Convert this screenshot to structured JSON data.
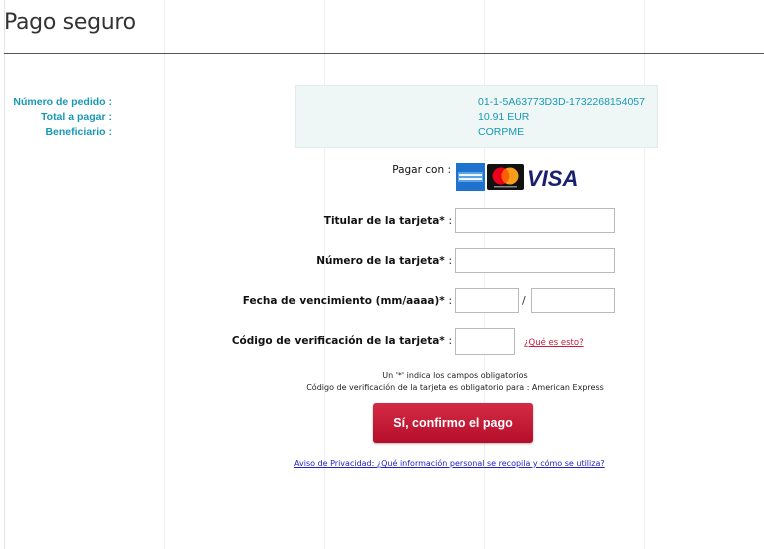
{
  "page": {
    "title": "Pago seguro"
  },
  "order": {
    "order_number_label": "Número de pedido :",
    "order_number": "01-1-5A63773D3D-1732268154057",
    "total_label": "Total a pagar :",
    "total": "10.91 EUR",
    "beneficiary_label": "Beneficiario :",
    "beneficiary": "CORPME"
  },
  "payment": {
    "pay_with_label": "Pagar con :",
    "cards": [
      "american-express-icon",
      "mastercard-icon",
      "visa-icon"
    ],
    "visa_text": "VISA"
  },
  "form": {
    "holder_label": "Titular de la tarjeta*",
    "holder_value": "",
    "number_label": "Número de la tarjeta*",
    "number_value": "",
    "expiry_label": "Fecha de vencimiento (mm/aaaa)*",
    "expiry_month": "",
    "expiry_year": "",
    "expiry_separator": "/",
    "cvv_label": "Código de verificación de la tarjeta*",
    "cvv_value": "",
    "cvv_help": "¿Qué es esto?",
    "colon": ":"
  },
  "notes": {
    "required_note": "Un '*' indica los campos obligatorios",
    "cvv_note": "Código de verificación de la tarjeta es obligatorio para : American Express"
  },
  "actions": {
    "confirm_label": "Sí, confirmo el pago"
  },
  "footer": {
    "privacy_link": "Aviso de Privacidad: ¿Qué información personal se recopila y cómo se utiliza?"
  },
  "colors": {
    "accent": "#c8102e",
    "info_text": "#1799b6",
    "info_bg": "#eef6f6"
  }
}
